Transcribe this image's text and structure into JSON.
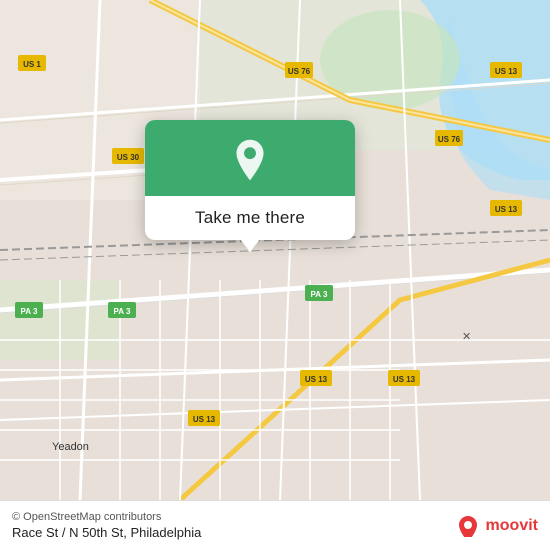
{
  "map": {
    "background_color": "#e8e0d8",
    "center_lat": 39.975,
    "center_lng": -75.22
  },
  "popup": {
    "button_label": "Take me there",
    "pin_color": "#3dab6e"
  },
  "bottom_bar": {
    "copyright": "© OpenStreetMap contributors",
    "location_title": "Race St / N 50th St, Philadelphia",
    "brand": "moovit"
  },
  "route_badges": [
    {
      "label": "US 1",
      "color": "yellow"
    },
    {
      "label": "US 30",
      "color": "yellow"
    },
    {
      "label": "PA 3",
      "color": "green"
    },
    {
      "label": "US 13",
      "color": "yellow"
    },
    {
      "label": "US 76",
      "color": "red"
    },
    {
      "label": "US 13",
      "color": "yellow"
    }
  ]
}
